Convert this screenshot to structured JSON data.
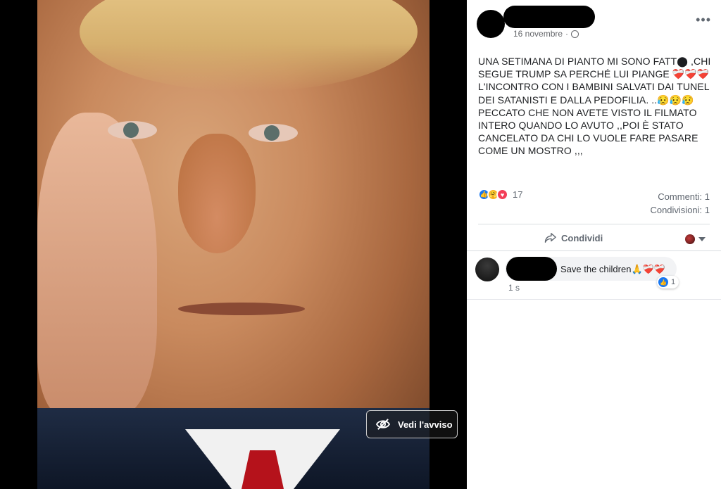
{
  "viewer": {
    "warning_button_label": "Vedi l'avviso",
    "warning_icon": "eye-slash-icon"
  },
  "post": {
    "date": "16 novembre",
    "audience_icon": "globe-icon",
    "more_icon": "ellipsis-icon",
    "text": "UNA SETIMANA DI PIANTO MI SONO FATT⬤ ,CHI\nSEGUE TRUMP SA PERCHÉ LUI PIANGE ❤️‍🩹❤️‍🩹❤️‍🩹\nL'INCONTRO CON I BAMBINI SALVATI DAI TUNEL\nDEI SATANISTI E DALLA PEDOFILIA. ..😥😥😥\nPECCATO CHE NON AVETE VISTO IL FILMATO\nINTERO QUANDO LO AVUTO ,,POI È STATO\nCANCELATO DA CHI LO VUOLE FARE PASARE\nCOME UN MOSTRO ,,,",
    "reactions": {
      "count": "17",
      "icons": [
        "like-icon",
        "care-icon",
        "love-icon"
      ]
    },
    "comments_label": "Commenti: 1",
    "shares_label": "Condivisioni: 1",
    "share_button_label": "Condividi",
    "share_icon": "share-arrow-icon"
  },
  "comment": {
    "text": "Save the children🙏❤️‍🩹❤️‍🩹",
    "time": "1 s",
    "reaction_count": "1",
    "reaction_icon": "like-icon"
  },
  "colors": {
    "like": "#1877f2",
    "love": "#f33e58",
    "care": "#f7b125",
    "muted_text": "#606770"
  }
}
